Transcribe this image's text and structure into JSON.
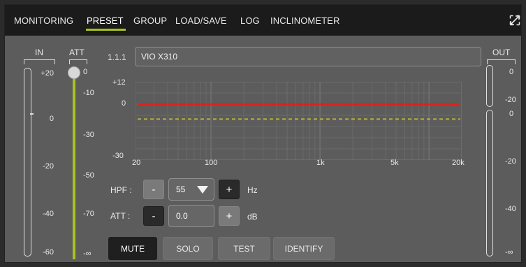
{
  "tabs": [
    {
      "label": "MONITORING",
      "active": false
    },
    {
      "label": "PRESET",
      "active": true
    },
    {
      "label": "GROUP",
      "active": false
    },
    {
      "label": "LOAD/SAVE",
      "active": false
    },
    {
      "label": "LOG",
      "active": false
    },
    {
      "label": "INCLINOMETER",
      "active": false
    }
  ],
  "in_meter": {
    "header": "IN",
    "scale": [
      "+20",
      "0",
      "-20",
      "-40",
      "-60"
    ]
  },
  "att_meter": {
    "header": "ATT",
    "scale": [
      "0",
      "-10",
      "-30",
      "-50",
      "-70",
      "-∞"
    ],
    "level_db": 0
  },
  "out_meter": {
    "header": "OUT",
    "scale_top": [
      "0",
      "-20"
    ],
    "scale_bottom": [
      "0",
      "-20",
      "-40",
      "-∞"
    ]
  },
  "preset": {
    "id": "1.1.1",
    "name": "VIO X310"
  },
  "graph": {
    "y_labels": [
      "+12",
      "0",
      "-30"
    ],
    "x_labels": [
      "20",
      "100",
      "1k",
      "5k",
      "20k"
    ],
    "response_color": "#e0201b",
    "reference_color": "#bfb232"
  },
  "hpf": {
    "label": "HPF :",
    "value": "55",
    "unit": "Hz",
    "minus": "-",
    "plus": "+"
  },
  "att": {
    "label": "ATT :",
    "value": "0.0",
    "unit": "dB",
    "minus": "-",
    "plus": "+"
  },
  "buttons": {
    "mute": "MUTE",
    "solo": "SOLO",
    "test": "TEST",
    "identify": "IDENTIFY"
  },
  "colors": {
    "accent": "#a9c21e",
    "panel": "#5c5c5c",
    "topbar": "#1b1b1b"
  }
}
